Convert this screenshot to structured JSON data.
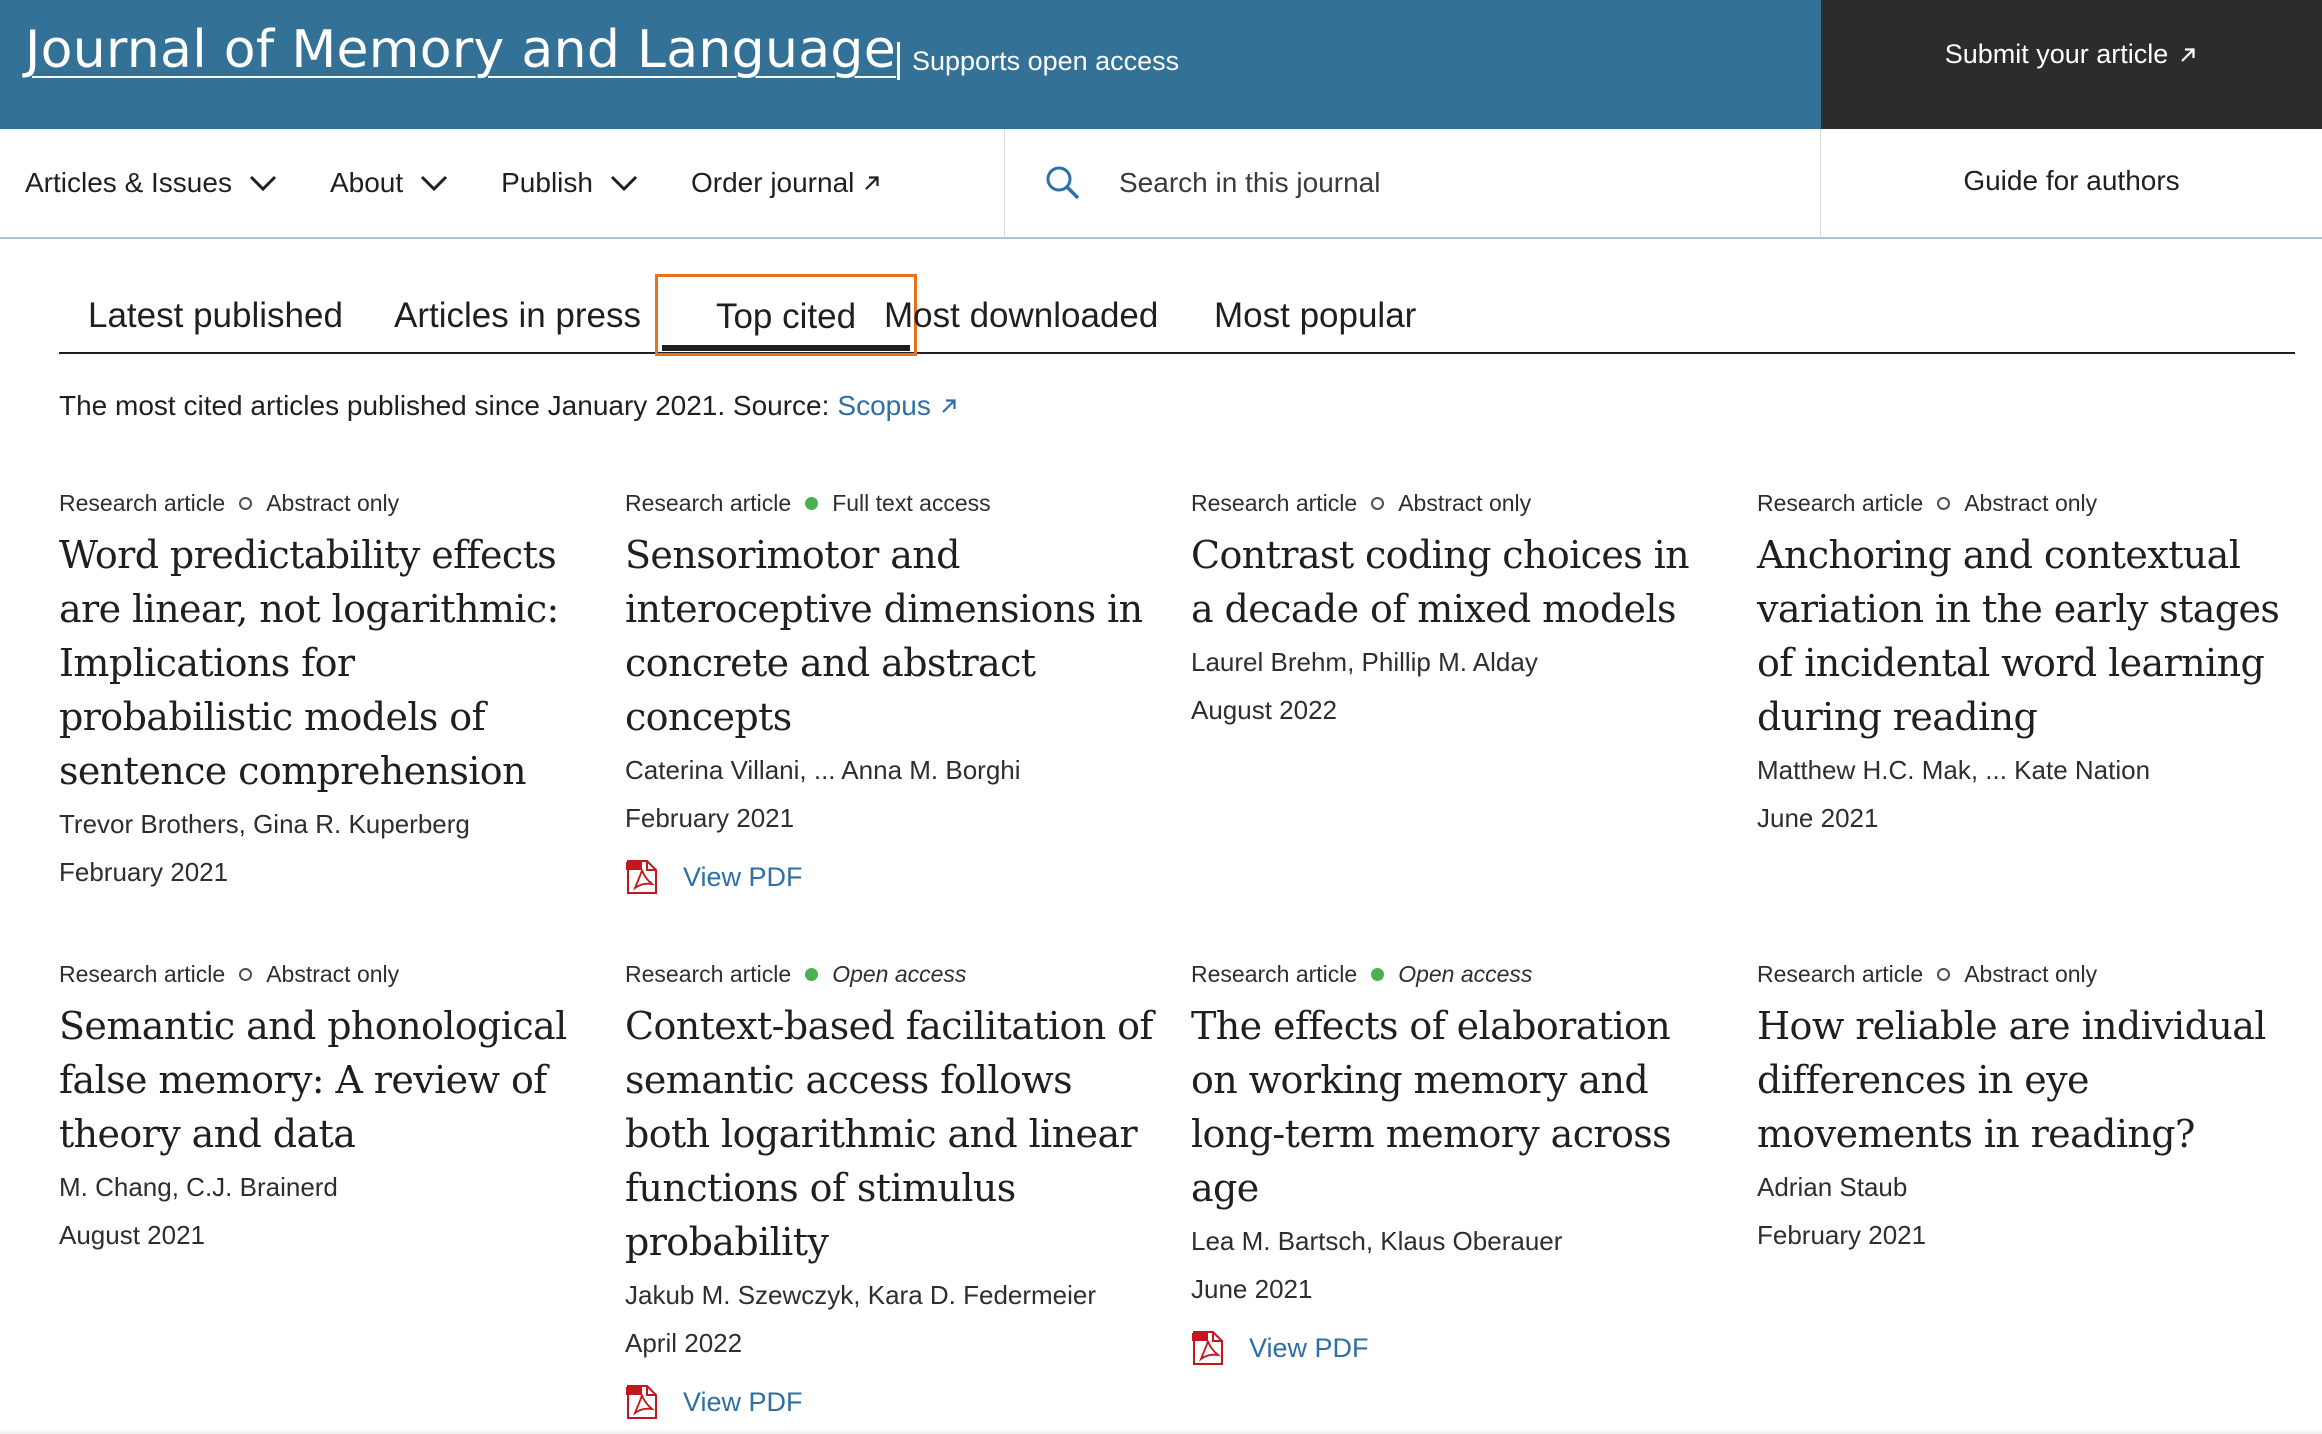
{
  "header": {
    "journal_title": "Journal of Memory and Language",
    "open_access_note": "Supports open access",
    "submit_label": "Submit your article"
  },
  "nav": {
    "items": [
      {
        "label": "Articles & Issues"
      },
      {
        "label": "About"
      },
      {
        "label": "Publish"
      },
      {
        "label": "Order journal"
      }
    ],
    "search_placeholder": "Search in this journal",
    "guide_label": "Guide for authors"
  },
  "tabs": {
    "items": [
      {
        "label": "Latest published"
      },
      {
        "label": "Articles in press"
      },
      {
        "label": "Top cited"
      },
      {
        "label": "Most downloaded"
      },
      {
        "label": "Most popular"
      }
    ],
    "active": "Top cited"
  },
  "intro": {
    "text": "The most cited articles published since January 2021. Source:",
    "source_link": "Scopus"
  },
  "colors": {
    "header_blue": "#337296",
    "submit_dark": "#2c2c2c",
    "link_blue": "#2e6fa5",
    "active_tab_outline": "#e9711c",
    "access_green": "#4caf50"
  },
  "articles": [
    {
      "type": "Research article",
      "access": "Abstract only",
      "title": "Word predictability effects are linear, not logarithmic: Implications for probabilistic models of sentence comprehension",
      "authors": "Trevor Brothers, Gina R. Kuperberg",
      "date": "February 2021"
    },
    {
      "type": "Research article",
      "access": "Full text access",
      "title": "Sensorimotor and interoceptive dimensions in concrete and abstract concepts",
      "authors": "Caterina Villani, ... Anna M. Borghi",
      "date": "February 2021",
      "pdf": "View PDF"
    },
    {
      "type": "Research article",
      "access": "Abstract only",
      "title": "Contrast coding choices in a decade of mixed models",
      "authors": "Laurel Brehm, Phillip M. Alday",
      "date": "August 2022"
    },
    {
      "type": "Research article",
      "access": "Abstract only",
      "title": "Anchoring and contextual variation in the early stages of incidental word learning during reading",
      "authors": "Matthew H.C. Mak, ... Kate Nation",
      "date": "June 2021"
    },
    {
      "type": "Research article",
      "access": "Abstract only",
      "title": "Semantic and phonological false memory: A review of theory and data",
      "authors": "M. Chang, C.J. Brainerd",
      "date": "August 2021"
    },
    {
      "type": "Research article",
      "access": "Open access",
      "title": "Context-based facilitation of semantic access follows both logarithmic and linear functions of stimulus probability",
      "authors": "Jakub M. Szewczyk, Kara D. Federmeier",
      "date": "April 2022",
      "pdf": "View PDF"
    },
    {
      "type": "Research article",
      "access": "Open access",
      "title": "The effects of elaboration on working memory and long-term memory across age",
      "authors": "Lea M. Bartsch, Klaus Oberauer",
      "date": "June 2021",
      "pdf": "View PDF"
    },
    {
      "type": "Research article",
      "access": "Abstract only",
      "title": "How reliable are individual differences in eye movements in reading?",
      "authors": "Adrian Staub",
      "date": "February 2021"
    }
  ]
}
